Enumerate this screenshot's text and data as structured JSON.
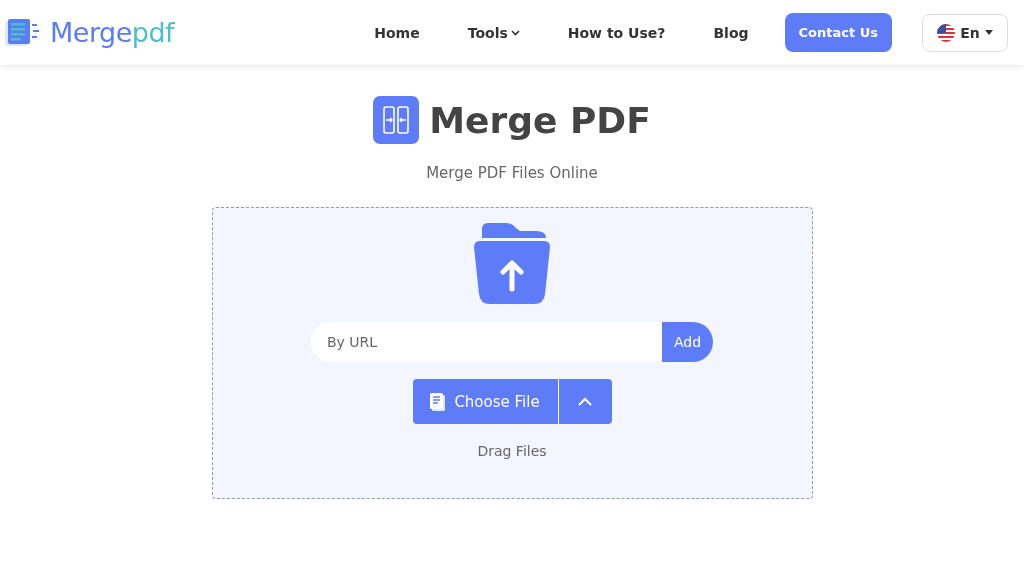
{
  "header": {
    "logo": {
      "parts": [
        {
          "text": "Merge",
          "color": "#5b7cf7"
        },
        {
          "text": "pdf",
          "color": "#4cbfc8"
        }
      ]
    },
    "nav": [
      {
        "label": "Home",
        "kind": "link"
      },
      {
        "label": "Tools",
        "kind": "dropdown"
      },
      {
        "label": "How to Use?",
        "kind": "link"
      },
      {
        "label": "Blog",
        "kind": "link"
      }
    ],
    "contact_button": "Contact Us",
    "language": "En"
  },
  "hero": {
    "title": "Merge PDF",
    "subtitle": "Merge PDF Files Online"
  },
  "upload": {
    "url_field": {
      "placeholder": "By URL"
    },
    "add_button": "Add",
    "choose_button": "Choose File",
    "hint": "Drag Files"
  }
}
